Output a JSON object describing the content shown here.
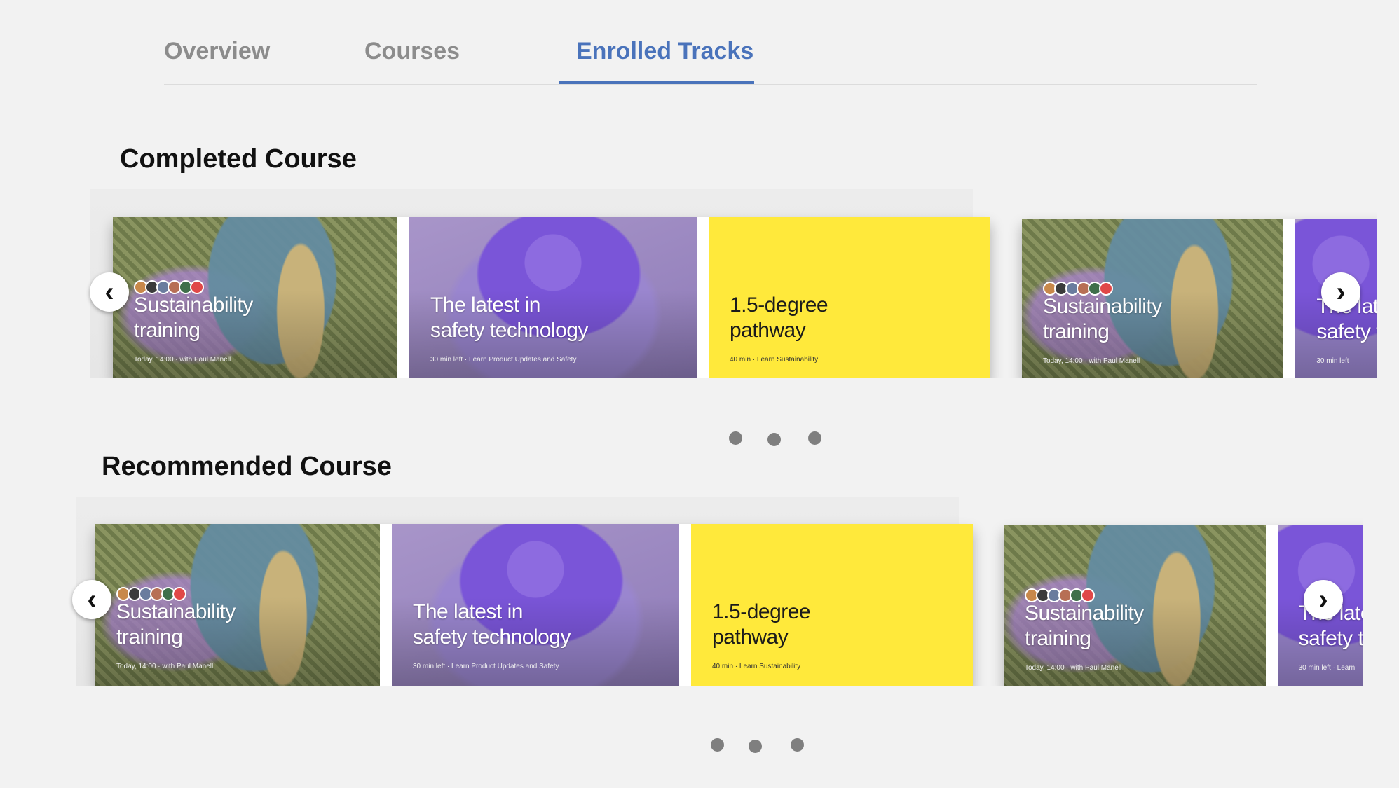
{
  "tabs": [
    {
      "label": "Overview"
    },
    {
      "label": "Courses"
    },
    {
      "label": "Enrolled Tracks",
      "active": true
    }
  ],
  "sections": [
    {
      "title": "Completed Course",
      "cards": [
        {
          "title_line1": "Sustainability",
          "title_line2": "training",
          "meta": "Today, 14:00 · with Paul Manell"
        },
        {
          "title_line1": "The latest in",
          "title_line2": "safety technology",
          "meta": "30 min left · Learn Product Updates and Safety"
        },
        {
          "title_line1": "1.5-degree",
          "title_line2": "pathway",
          "meta": "40 min · Learn Sustainability"
        },
        {
          "title_line1": "Sustainability",
          "title_line2": "training",
          "meta": "Today, 14:00 · with Paul Manell"
        },
        {
          "title_line1": "The latest in",
          "title_line2": "safety technology",
          "meta": "30 min left"
        }
      ],
      "page_count": 3
    },
    {
      "title": "Recommended Course",
      "cards": [
        {
          "title_line1": "Sustainability",
          "title_line2": "training",
          "meta": "Today, 14:00 · with Paul Manell"
        },
        {
          "title_line1": "The latest in",
          "title_line2": "safety technology",
          "meta": "30 min left · Learn Product Updates and Safety"
        },
        {
          "title_line1": "1.5-degree",
          "title_line2": "pathway",
          "meta": "40 min · Learn Sustainability"
        },
        {
          "title_line1": "Sustainability",
          "title_line2": "training",
          "meta": "Today, 14:00 · with Paul Manell"
        },
        {
          "title_line1": "The latest in",
          "title_line2": "safety technology",
          "meta": "30 min left · Learn"
        }
      ],
      "page_count": 3
    }
  ],
  "icons": {
    "prev": "chevron-left-icon",
    "next": "chevron-right-icon"
  },
  "colors": {
    "accent": "#4a73bb",
    "pathway_yellow": "#ffe93b",
    "dot": "#7f7f7f"
  }
}
